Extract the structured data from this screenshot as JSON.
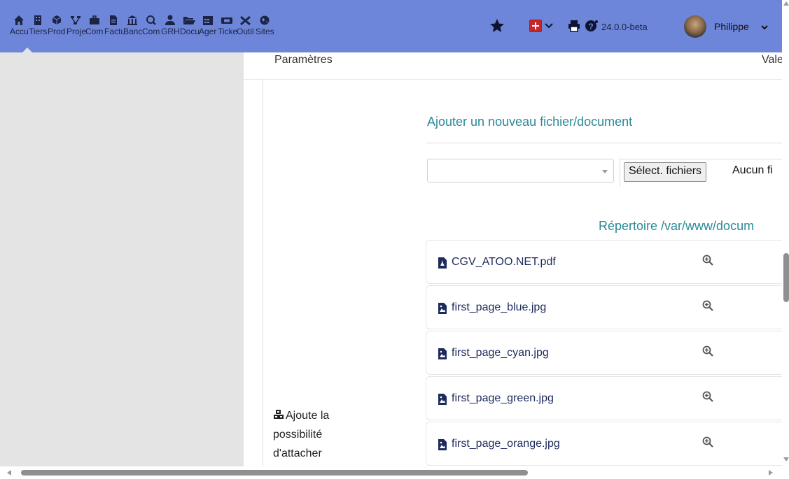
{
  "topbar": {
    "menu": [
      {
        "label": "Accu",
        "icon": "home-icon"
      },
      {
        "label": "Tiers",
        "icon": "building-icon"
      },
      {
        "label": "Prod",
        "icon": "cube-icon"
      },
      {
        "label": "Proje",
        "icon": "project-icon"
      },
      {
        "label": "Com",
        "icon": "briefcase-icon"
      },
      {
        "label": "Factu",
        "icon": "invoice-icon"
      },
      {
        "label": "Banc",
        "icon": "bank-icon"
      },
      {
        "label": "Com",
        "icon": "search-dollar-icon"
      },
      {
        "label": "GRH",
        "icon": "user-tie-icon"
      },
      {
        "label": "Docu",
        "icon": "folder-open-icon"
      },
      {
        "label": "Ager",
        "icon": "calendar-icon"
      },
      {
        "label": "Ticke",
        "icon": "ticket-icon"
      },
      {
        "label": "Outil",
        "icon": "tools-icon"
      },
      {
        "label": "Sites",
        "icon": "globe-icon"
      }
    ],
    "version": "24.0.0-beta",
    "username": "Philippe",
    "colors": {
      "bar": "#6e86d9",
      "accent_link": "#2a8a98"
    }
  },
  "main": {
    "col_params": "Paramètres",
    "col_value": "Vale",
    "add_title": "Ajouter un nouveau fichier/document",
    "file_button": "Sélect. fichiers",
    "no_file": "Aucun fi",
    "directory": "Répertoire /var/www/docum",
    "files": [
      {
        "name": "CGV_ATOO.NET.pdf",
        "type": "pdf"
      },
      {
        "name": "first_page_blue.jpg",
        "type": "image"
      },
      {
        "name": "first_page_cyan.jpg",
        "type": "image"
      },
      {
        "name": "first_page_green.jpg",
        "type": "image"
      },
      {
        "name": "first_page_orange.jpg",
        "type": "image"
      }
    ],
    "sidenote": "Ajoute la possibilité d'attacher"
  }
}
